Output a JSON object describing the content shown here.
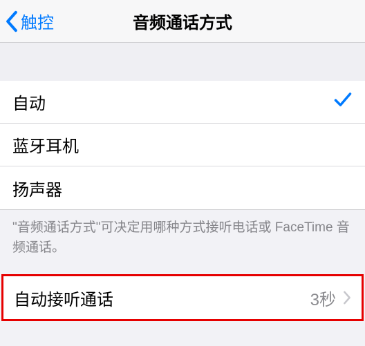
{
  "nav": {
    "back": "触控",
    "title": "音频通话方式"
  },
  "options": {
    "auto": "自动",
    "bluetooth": "蓝牙耳机",
    "speaker": "扬声器"
  },
  "footer": "\"音频通话方式\"可决定用哪种方式接听电话或 FaceTime 音频通话。",
  "auto_answer": {
    "label": "自动接听通话",
    "value": "3秒"
  }
}
